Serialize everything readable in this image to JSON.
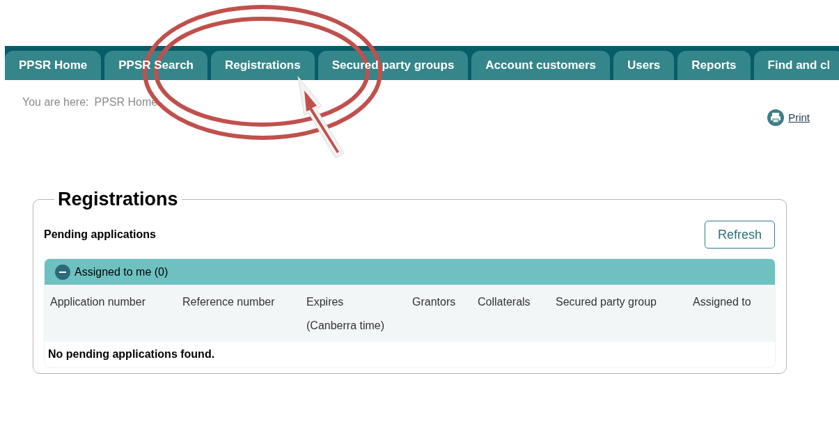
{
  "tabs": [
    {
      "label": "PPSR Home"
    },
    {
      "label": "PPSR Search"
    },
    {
      "label": "Registrations"
    },
    {
      "label": "Secured party groups"
    },
    {
      "label": "Account customers"
    },
    {
      "label": "Users"
    },
    {
      "label": "Reports"
    },
    {
      "label": "Find and cl"
    }
  ],
  "breadcrumb": {
    "label": "You are here:",
    "current": "PPSR Home"
  },
  "print_link": "Print",
  "section": {
    "title": "Registrations",
    "subtitle": "Pending applications",
    "refresh_button": "Refresh",
    "accordion": {
      "label": "Assigned to me (0)",
      "expanded": true,
      "columns": [
        "Application number",
        "Reference number",
        "Expires (Canberra time)",
        "Grantors",
        "Collaterals",
        "Secured party group",
        "Assigned to"
      ],
      "empty_message": "No pending applications found."
    }
  }
}
